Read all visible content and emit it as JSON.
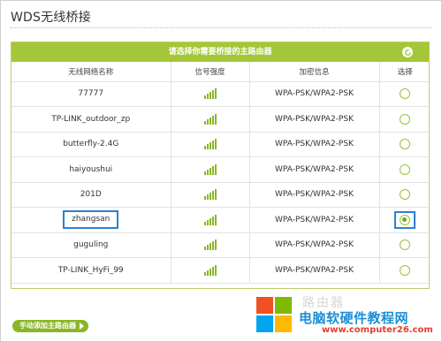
{
  "page": {
    "title": "WDS无线桥接"
  },
  "panel": {
    "header": "请选择你需要桥接的主路由器"
  },
  "table": {
    "headers": [
      "无线网络名称",
      "信号强度",
      "加密信息",
      "选择"
    ],
    "rows": [
      {
        "ssid": "77777",
        "signal_bars": 5,
        "encryption": "WPA-PSK/WPA2-PSK",
        "selected": false
      },
      {
        "ssid": "TP-LINK_outdoor_zp",
        "signal_bars": 5,
        "encryption": "WPA-PSK/WPA2-PSK",
        "selected": false
      },
      {
        "ssid": "butterfly-2.4G",
        "signal_bars": 5,
        "encryption": "WPA-PSK/WPA2-PSK",
        "selected": false
      },
      {
        "ssid": "haiyoushui",
        "signal_bars": 5,
        "encryption": "WPA-PSK/WPA2-PSK",
        "selected": false
      },
      {
        "ssid": "201D",
        "signal_bars": 5,
        "encryption": "WPA-PSK/WPA2-PSK",
        "selected": false
      },
      {
        "ssid": "zhangsan",
        "signal_bars": 5,
        "encryption": "WPA-PSK/WPA2-PSK",
        "selected": true
      },
      {
        "ssid": "guguling",
        "signal_bars": 5,
        "encryption": "WPA-PSK/WPA2-PSK",
        "selected": false
      },
      {
        "ssid": "TP-LINK_HyFi_99",
        "signal_bars": 5,
        "encryption": "WPA-PSK/WPA2-PSK",
        "selected": false
      }
    ]
  },
  "manual_add_button": "手动添加主路由器",
  "watermark": {
    "ghost": "路由器",
    "text": "电脑软硬件教程网",
    "url": "www.computer26.com"
  },
  "colors": {
    "accent_green": "#a4c639",
    "highlight_blue": "#2f7fd0"
  },
  "icons": {
    "refresh": "refresh-icon",
    "signal": "signal-strength-icon",
    "arrow": "play-arrow-icon"
  }
}
